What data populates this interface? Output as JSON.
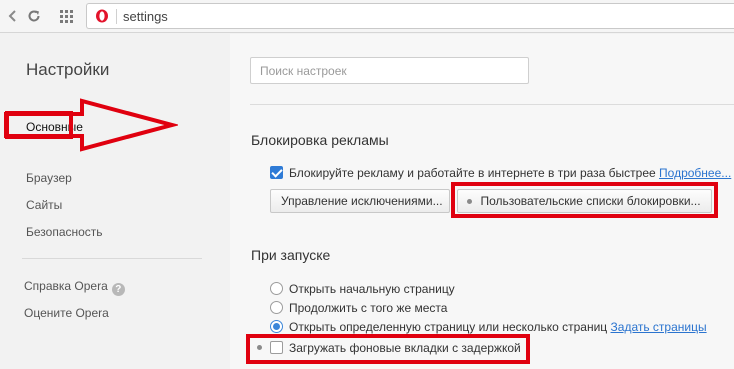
{
  "browser": {
    "back_icon": "back-arrow-icon",
    "reload_icon": "reload-icon",
    "grid_icon": "speed-dial-icon",
    "address_text": "settings",
    "logo": "opera-logo-icon"
  },
  "sidebar": {
    "title": "Настройки",
    "items": [
      {
        "label": "Основные"
      },
      {
        "label": "Браузер"
      },
      {
        "label": "Сайты"
      },
      {
        "label": "Безопасность"
      }
    ],
    "footer_items": [
      {
        "label": "Справка Opera"
      },
      {
        "label": "Оцените Opera"
      }
    ],
    "help_icon": "?"
  },
  "search": {
    "placeholder": "Поиск настроек",
    "value": ""
  },
  "ad_block": {
    "title": "Блокировка рекламы",
    "checkbox_label": "Блокируйте рекламу и работайте в интернете в три раза быстрее",
    "more_link": "Подробнее...",
    "exceptions_button": "Управление исключениями...",
    "custom_lists_button": "Пользовательские списки блокировки..."
  },
  "startup": {
    "title": "При запуске",
    "options": [
      {
        "label": "Открыть начальную страницу"
      },
      {
        "label": "Продолжить с того же места"
      },
      {
        "label": "Открыть определенную страницу или несколько страниц"
      }
    ],
    "set_pages_link": "Задать страницы",
    "background_tabs_label": "Загружать фоновые вкладки с задержкой"
  },
  "annotation_color": "#e0000f"
}
